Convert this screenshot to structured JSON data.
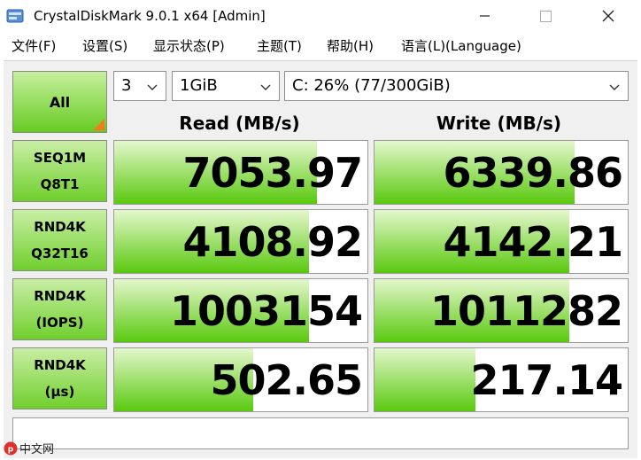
{
  "window": {
    "title": "CrystalDiskMark 9.0.1 x64 [Admin]"
  },
  "menu": [
    {
      "label": "文件(F)"
    },
    {
      "label": "设置(S)"
    },
    {
      "label": "显示状态(P)"
    },
    {
      "label": "主题(T)"
    },
    {
      "label": "帮助(H)"
    },
    {
      "label": "语言(L)(Language)"
    }
  ],
  "controls": {
    "all_label": "All",
    "count_value": "3",
    "size_value": "1GiB",
    "drive_value": "C: 26% (77/300GiB)"
  },
  "headers": {
    "read": "Read (MB/s)",
    "write": "Write (MB/s)"
  },
  "rows": [
    {
      "line1": "SEQ1M",
      "line2": "Q8T1",
      "read": "7053.97",
      "write": "6339.86",
      "read_fill": 0.8,
      "write_fill": 0.79
    },
    {
      "line1": "RND4K",
      "line2": "Q32T16",
      "read": "4108.92",
      "write": "4142.21",
      "read_fill": 0.77,
      "write_fill": 0.77
    },
    {
      "line1": "RND4K",
      "line2": "(IOPS)",
      "read": "1003154",
      "write": "1011282",
      "read_fill": 0.77,
      "write_fill": 0.77
    },
    {
      "line1": "RND4K",
      "line2": "(μs)",
      "read": "502.65",
      "write": "217.14",
      "read_fill": 0.55,
      "write_fill": 0.4
    }
  ],
  "comment": "",
  "watermark": {
    "text": "中文网"
  },
  "colors": {
    "bar_green": "#59c90e",
    "corner_orange": "#ef7d1f",
    "close_gray": "#333333"
  }
}
